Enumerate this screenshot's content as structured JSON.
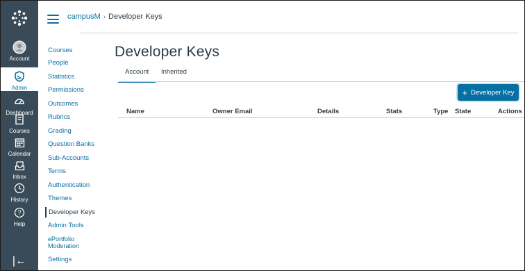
{
  "global_nav": {
    "items": [
      {
        "label": "Account",
        "icon": "avatar-icon"
      },
      {
        "label": "Admin",
        "icon": "shield-icon"
      },
      {
        "label": "Dashboard",
        "icon": "dashboard-icon"
      },
      {
        "label": "Courses",
        "icon": "book-icon"
      },
      {
        "label": "Calendar",
        "icon": "calendar-icon"
      },
      {
        "label": "Inbox",
        "icon": "inbox-icon"
      },
      {
        "label": "History",
        "icon": "clock-icon"
      },
      {
        "label": "Help",
        "icon": "help-icon"
      }
    ],
    "active": "Admin",
    "collapse_glyph": "|←"
  },
  "breadcrumb": {
    "root": "campusM",
    "separator": "›",
    "current": "Developer Keys"
  },
  "subnav": {
    "items": [
      "Courses",
      "People",
      "Statistics",
      "Permissions",
      "Outcomes",
      "Rubrics",
      "Grading",
      "Question Banks",
      "Sub-Accounts",
      "Terms",
      "Authentication",
      "Themes",
      "Developer Keys",
      "Admin Tools",
      "ePortfolio",
      "Moderation",
      "Settings"
    ],
    "active": "Developer Keys"
  },
  "page": {
    "title": "Developer Keys",
    "tabs": [
      {
        "label": "Account",
        "active": true
      },
      {
        "label": "Inherited",
        "active": false
      }
    ],
    "add_button": {
      "plus": "+",
      "label": "Developer Key"
    },
    "table": {
      "columns": [
        "Name",
        "Owner Email",
        "Details",
        "Stats",
        "Type",
        "State",
        "Actions"
      ]
    }
  },
  "colors": {
    "nav_bg": "#394b58",
    "link": "#0770a3",
    "text": "#2d3b45",
    "divider": "#c7cdd1"
  }
}
